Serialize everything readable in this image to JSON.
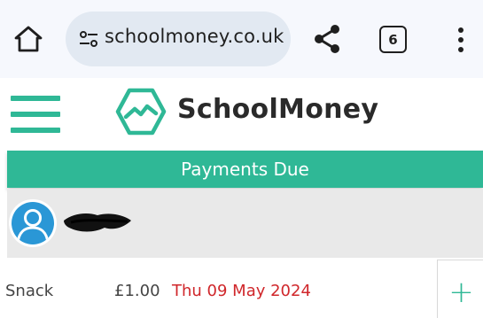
{
  "browser": {
    "url": "schoolmoney.co.uk",
    "tab_count": "6",
    "icons": [
      "home-icon",
      "site-settings-icon",
      "share-icon",
      "tab-switcher-icon",
      "more-vert-icon"
    ]
  },
  "app": {
    "brand": "SchoolMoney",
    "banner_title": "Payments Due",
    "accent_color": "#2fb896"
  },
  "payments": [
    {
      "name": "Snack",
      "amount": "£1.00",
      "due_date": "Thu 09 May 2024",
      "due_color": "#d0272b",
      "action": "+"
    }
  ]
}
